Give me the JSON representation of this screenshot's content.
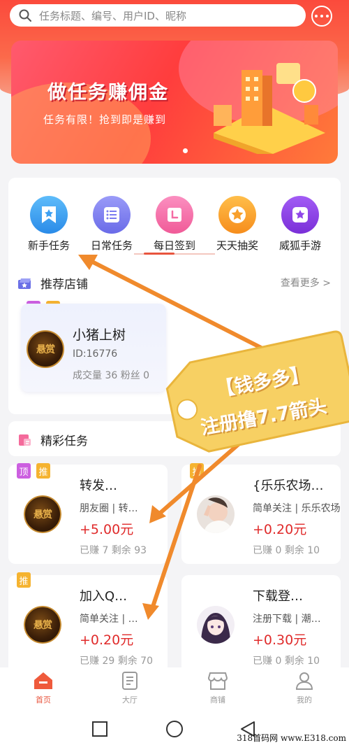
{
  "search": {
    "placeholder": "任务标题、编号、用户ID、昵称"
  },
  "banner": {
    "title": "做任务赚佣金",
    "subtitle": "任务有限！抢到即是赚到"
  },
  "menu": [
    {
      "label": "新手任务",
      "icon": "bookmark-star-icon",
      "color": "#3ea0f2"
    },
    {
      "label": "日常任务",
      "icon": "list-icon",
      "color": "#7b7cf0"
    },
    {
      "label": "每日签到",
      "icon": "calendar-icon",
      "color": "#f46ba3"
    },
    {
      "label": "天天抽奖",
      "icon": "star-icon",
      "color": "#f8a02c"
    },
    {
      "label": "威狐手游",
      "icon": "game-star-icon",
      "color": "#8f45e8"
    }
  ],
  "shops_section": {
    "title": "推荐店铺",
    "more": "查看更多 >"
  },
  "shop": {
    "tags": [
      "顶",
      "推"
    ],
    "avatar_text": "悬赏",
    "name": "小猪上树",
    "id": "ID:16776",
    "stats": "成交量 36 粉丝 0"
  },
  "tasks_section": {
    "title": "精彩任务"
  },
  "tasks": [
    {
      "tags": [
        "顶",
        "推"
      ],
      "name": "转发…",
      "type": "朋友圈 | 转…",
      "price": "+5.00元",
      "earned": "已赚 7 剩余 93",
      "avatar": "gold"
    },
    {
      "tags": [
        "推"
      ],
      "name": "{乐乐农场…",
      "type": "简单关注 | 乐乐农场",
      "price": "+0.20元",
      "earned": "已赚 0 剩余 10",
      "avatar": "photo"
    },
    {
      "tags": [
        "推"
      ],
      "name": "加入Q…",
      "type": "简单关注 | …",
      "price": "+0.20元",
      "earned": "已赚 29 剩余 70",
      "avatar": "gold"
    },
    {
      "tags": [],
      "name": "下载登…",
      "type": "注册下载 | 潮…",
      "price": "+0.30元",
      "earned": "已赚 0 剩余 10",
      "avatar": "anime"
    }
  ],
  "promo": {
    "line1": "【钱多多】",
    "line2": "注册撸7.7箭头"
  },
  "tabbar": [
    {
      "label": "首页",
      "icon": "home-icon",
      "active": true
    },
    {
      "label": "大厅",
      "icon": "document-icon",
      "active": false
    },
    {
      "label": "商铺",
      "icon": "store-icon",
      "active": false
    },
    {
      "label": "我的",
      "icon": "user-icon",
      "active": false
    }
  ],
  "watermark": "318首码网 www.E318.com",
  "colors": {
    "accent": "#e8553e",
    "price": "#e02b2b",
    "header": "#fb4a3c"
  }
}
